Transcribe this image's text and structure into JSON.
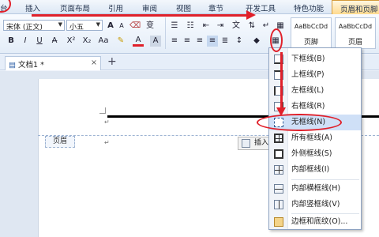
{
  "tabs": [
    "台",
    "插入",
    "页面布局",
    "引用",
    "审阅",
    "视图",
    "章节",
    "开发工具",
    "特色功能",
    "页眉和页脚"
  ],
  "ribbon": {
    "font_name": "宋体 (正文)",
    "font_size": "小五",
    "bold": "B",
    "italic": "I",
    "underline": "U",
    "grow_font": "A",
    "text_color": "A",
    "style_preview_1": "AaBbCcDd",
    "style_preview_2": "AaBbCcDd",
    "style_name_1": "页脚",
    "style_name_2": "页眉"
  },
  "doc_tab": {
    "title": "文档1 *",
    "close": "×",
    "new_tab": "+"
  },
  "document": {
    "header_badge": "页眉",
    "insert_button": "插入",
    "para_mark": "↵"
  },
  "menu": {
    "items": [
      "下框线(B)",
      "上框线(P)",
      "左框线(L)",
      "右框线(R)",
      "无框线(N)",
      "所有框线(A)",
      "外侧框线(S)",
      "内部框线(I)",
      "内部横框线(H)",
      "内部竖框线(V)",
      "边框和底纹(O)..."
    ],
    "highlighted": "无框线(N)"
  },
  "colors": {
    "annotation": "#e0202a",
    "active_tab": "#ffd98a",
    "menu_highlight": "#cfe0f7"
  }
}
